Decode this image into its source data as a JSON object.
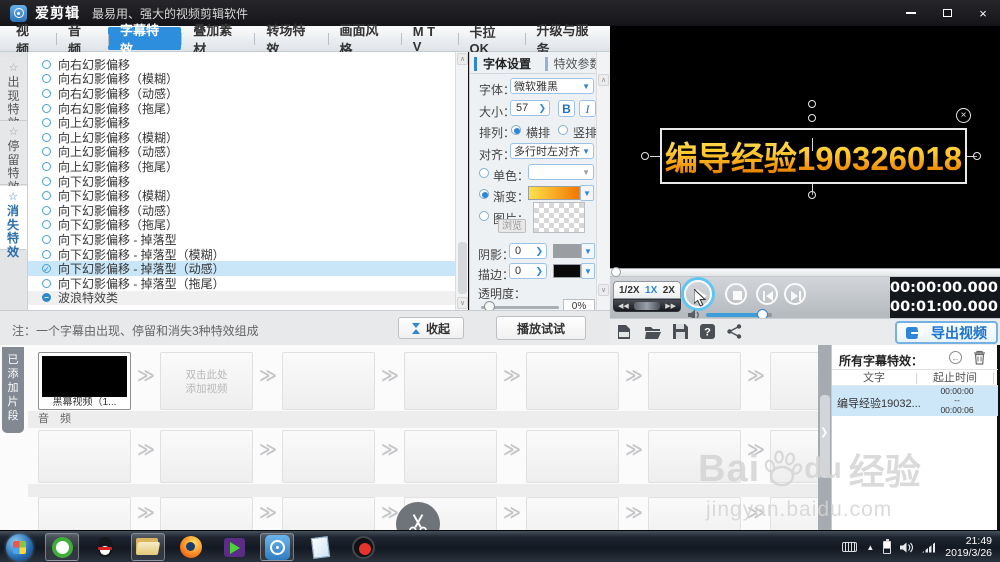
{
  "window": {
    "app_name": "爱剪辑",
    "tagline": "最易用、强大的视频剪辑软件"
  },
  "menu_tabs": {
    "items": [
      {
        "label": "视 频",
        "active": false
      },
      {
        "label": "音 频",
        "active": false
      },
      {
        "label": "字幕特效",
        "active": true
      },
      {
        "label": "叠加素材",
        "active": false
      },
      {
        "label": "转场特效",
        "active": false
      },
      {
        "label": "画面风格",
        "active": false
      },
      {
        "label": "M T V",
        "active": false
      },
      {
        "label": "卡拉OK",
        "active": false
      },
      {
        "label": "升级与服务",
        "active": false
      }
    ]
  },
  "effect_category_tabs": [
    {
      "label": "出现特效",
      "active": false
    },
    {
      "label": "停留特效",
      "active": false
    },
    {
      "label": "消失特效",
      "active": true
    }
  ],
  "effect_list": {
    "items": [
      {
        "label": "向右幻影偏移"
      },
      {
        "label": "向右幻影偏移（模糊）"
      },
      {
        "label": "向右幻影偏移（动感）"
      },
      {
        "label": "向右幻影偏移（拖尾）"
      },
      {
        "label": "向上幻影偏移"
      },
      {
        "label": "向上幻影偏移（模糊）"
      },
      {
        "label": "向上幻影偏移（动感）"
      },
      {
        "label": "向上幻影偏移（拖尾）"
      },
      {
        "label": "向下幻影偏移"
      },
      {
        "label": "向下幻影偏移（模糊）"
      },
      {
        "label": "向下幻影偏移（动感）"
      },
      {
        "label": "向下幻影偏移（拖尾）"
      },
      {
        "label": "向下幻影偏移 - 掉落型"
      },
      {
        "label": "向下幻影偏移 - 掉落型（模糊）"
      },
      {
        "label": "向下幻影偏移 - 掉落型（动感）",
        "selected": true
      },
      {
        "label": "向下幻影偏移 - 掉落型（拖尾）"
      },
      {
        "label": "波浪特效类",
        "category": true
      }
    ],
    "note": "注：一个字幕由出现、停留和消失3种特效组成",
    "collapse_button": "收起"
  },
  "font_panel": {
    "tab_font": "字体设置",
    "tab_effect": "特效参数",
    "font_label": "字体：",
    "font_value": "微软雅黑",
    "size_label": "大小：",
    "size_value": "57",
    "bold_button": "B",
    "italic_button": "I",
    "arrange_label": "排列：",
    "horizontal_option": "横排",
    "vertical_option": "竖排",
    "align_label": "对齐：",
    "align_value": "多行时左对齐",
    "solid_label": "单色：",
    "gradient_label": "渐变：",
    "image_label": "图片：",
    "browse_button": "浏览",
    "shadow_label": "阴影：",
    "shadow_value": "0",
    "outline_label": "描边：",
    "outline_value": "0",
    "opacity_label": "透明度：",
    "opacity_value": "0%",
    "play_test_button": "播放试试"
  },
  "preview": {
    "overlay_text": "编导经验190326018"
  },
  "transport": {
    "speed_options": [
      "1/2X",
      "1X",
      "2X"
    ],
    "speed_selected": "1X",
    "current_time": "00:00:00.000",
    "total_time": "00:01:00.000",
    "export_button": "导出视频"
  },
  "timeline": {
    "clips_tab": "已添加片段",
    "clip_label": "黑幕视频（1...",
    "placeholder_line1": "双击此处",
    "placeholder_line2": "添加视频",
    "audio_label": "音 频"
  },
  "subtitle_panel": {
    "title": "所有字幕特效：",
    "col_text": "文字",
    "col_time": "起止时间",
    "rows": [
      {
        "text": "编导经验19032...",
        "start": "00:00:00",
        "sep": "--",
        "end": "00:00:06"
      }
    ]
  },
  "watermark": {
    "brand": "Bai",
    "brand2": "du",
    "brand_cn": "经验",
    "url": "jingyan.baidu.com"
  },
  "taskbar": {
    "apps": [
      {
        "name": "start-button",
        "type": "start",
        "running": false
      },
      {
        "name": "browser-360-icon",
        "type": "b360",
        "running": true
      },
      {
        "name": "qq-icon",
        "type": "qq",
        "running": false
      },
      {
        "name": "file-explorer-icon",
        "type": "exp",
        "running": true
      },
      {
        "name": "firefox-icon",
        "type": "ff",
        "running": false
      },
      {
        "name": "media-player-icon",
        "type": "med",
        "running": false
      },
      {
        "name": "aijianji-icon",
        "type": "ajj",
        "running": true
      },
      {
        "name": "notepad-icon",
        "type": "note",
        "running": false
      },
      {
        "name": "screen-recorder-icon",
        "type": "rec",
        "running": false
      }
    ],
    "clock_time": "21:49",
    "clock_date": "2019/3/26"
  },
  "icons": {
    "star": "☆",
    "selected_check": "✓",
    "category_collapse": "−",
    "chevron_separator": "≫",
    "dropdown_arrow": "▼",
    "spinner_arrow": "❯",
    "scroll_up": "∧",
    "scroll_down": "∨",
    "splitter_arrow": "❯",
    "close_x": "×",
    "undo_arrow": "←",
    "notch_down": "⌄",
    "jog_left": "◀◀",
    "jog_right": "▶▶",
    "tray_hidden": "▲"
  },
  "colors": {
    "accent_blue": "#2e8ede",
    "selection_blue": "#c9e6f9",
    "overlay_gradient_top": "#ffe45e",
    "overlay_gradient_bottom": "#c96e00",
    "gradient_swatch_left": "#ffe14d",
    "gradient_swatch_right": "#f07800"
  }
}
